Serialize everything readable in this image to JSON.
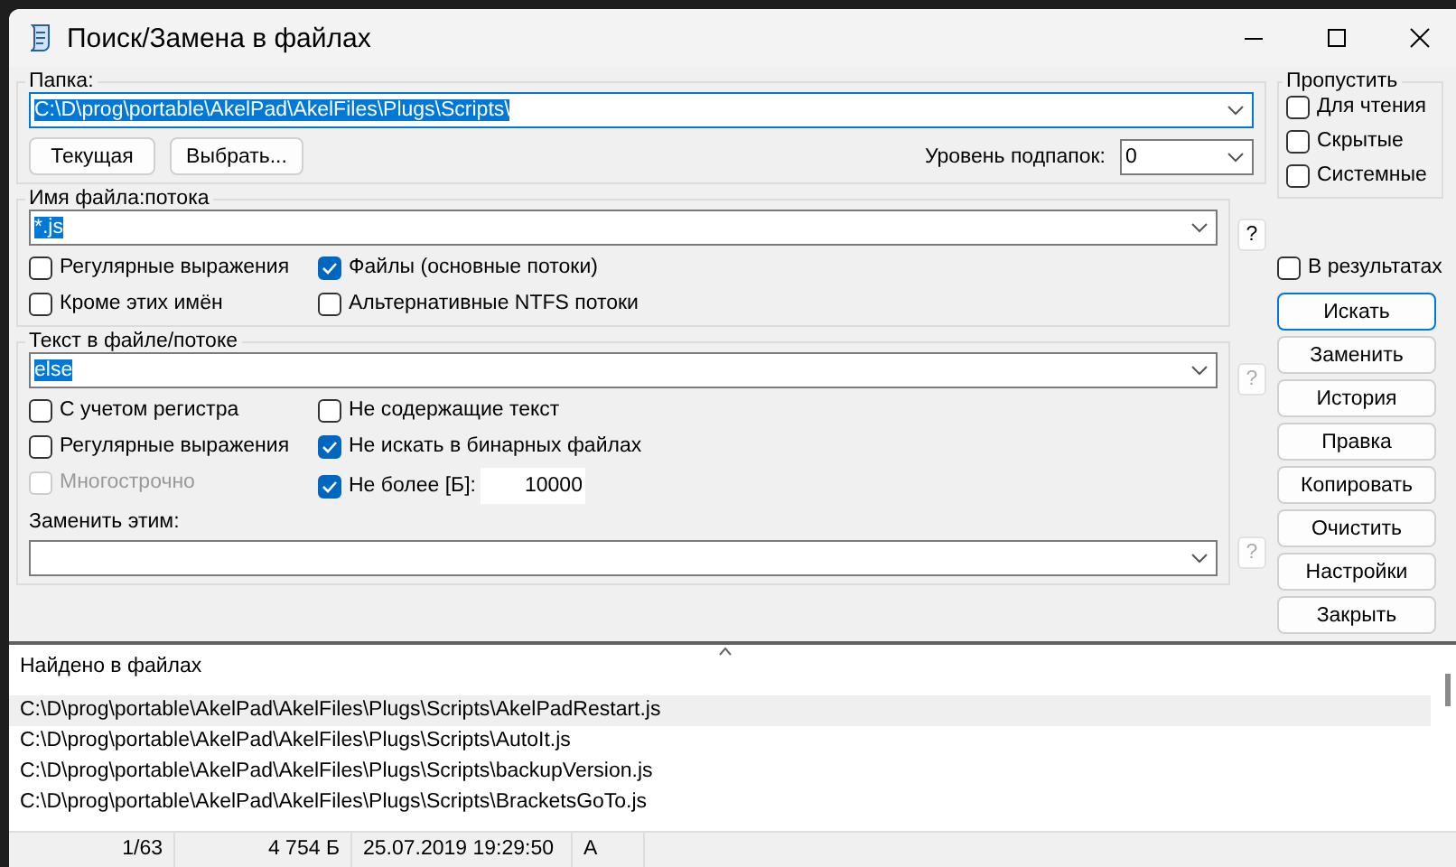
{
  "window": {
    "title": "Поиск/Замена в файлах"
  },
  "folder": {
    "legend": "Папка:",
    "value": "C:\\D\\prog\\portable\\AkelPad\\AkelFiles\\Plugs\\Scripts\\",
    "value_selected": true,
    "buttons": [
      "Текущая",
      "Выбрать..."
    ],
    "depth_label": "Уровень подпапок:",
    "depth_value": "0"
  },
  "skip": {
    "legend": "Пропустить",
    "options": [
      {
        "label": "Для чтения",
        "checked": false
      },
      {
        "label": "Скрытые",
        "checked": false
      },
      {
        "label": "Системные",
        "checked": false
      }
    ]
  },
  "filename": {
    "legend": "Имя файла:потока",
    "value": "*.js",
    "value_selected": true,
    "help": {
      "label": "?",
      "disabled": false
    },
    "options": [
      {
        "label": "Регулярные выражения",
        "checked": false,
        "disabled": false
      },
      {
        "label": "Файлы (основные потоки)",
        "checked": true,
        "disabled": false
      },
      {
        "label": "Кроме этих имён",
        "checked": false,
        "disabled": false
      },
      {
        "label": "Альтернативные NTFS потоки",
        "checked": false,
        "disabled": false
      }
    ]
  },
  "text": {
    "legend": "Текст в файле/потоке",
    "value": "else",
    "value_selected": true,
    "help": {
      "label": "?",
      "disabled": true
    },
    "options": [
      {
        "label": "С учетом регистра",
        "checked": false,
        "disabled": false
      },
      {
        "label": "Не содержащие текст",
        "checked": false,
        "disabled": false
      },
      {
        "label": "Регулярные выражения",
        "checked": false,
        "disabled": false
      },
      {
        "label": "Не искать в бинарных файлах",
        "checked": true,
        "disabled": false
      },
      {
        "label": "Многострочно",
        "checked": false,
        "disabled": true
      },
      {
        "label": "Не более [Б]:",
        "checked": true,
        "disabled": false,
        "limit": "10000"
      }
    ],
    "replace_label": "Заменить этим:",
    "replace_help": {
      "label": "?",
      "disabled": true
    }
  },
  "in_results": {
    "label": "В результатах",
    "checked": false
  },
  "actions": [
    {
      "label": "Искать",
      "default": true
    },
    {
      "label": "Заменить",
      "default": false
    },
    {
      "label": "История",
      "default": false
    },
    {
      "label": "Правка",
      "default": false
    },
    {
      "label": "Копировать",
      "default": false
    },
    {
      "label": "Очистить",
      "default": false
    },
    {
      "label": "Настройки",
      "default": false
    },
    {
      "label": "Закрыть",
      "default": false
    }
  ],
  "results": {
    "title": "Найдено в файлах",
    "rows": [
      {
        "path": "C:\\D\\prog\\portable\\AkelPad\\AkelFiles\\Plugs\\Scripts\\AkelPadRestart.js",
        "selected": true
      },
      {
        "path": "C:\\D\\prog\\portable\\AkelPad\\AkelFiles\\Plugs\\Scripts\\AutoIt.js",
        "selected": false
      },
      {
        "path": "C:\\D\\prog\\portable\\AkelPad\\AkelFiles\\Plugs\\Scripts\\backupVersion.js",
        "selected": false
      },
      {
        "path": "C:\\D\\prog\\portable\\AkelPad\\AkelFiles\\Plugs\\Scripts\\BracketsGoTo.js",
        "selected": false
      }
    ]
  },
  "status_bar": [
    "1/63",
    "4 754 Б",
    "25.07.2019  19:29:50",
    "A"
  ]
}
